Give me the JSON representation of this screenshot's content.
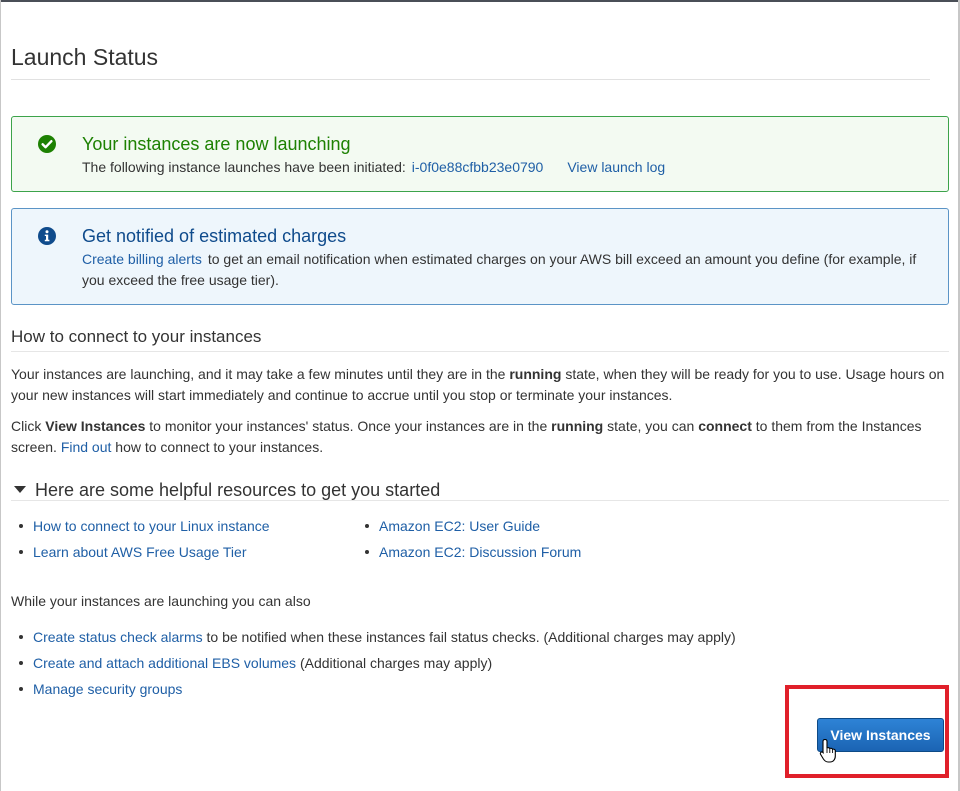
{
  "page": {
    "title": "Launch Status"
  },
  "success_alert": {
    "title": "Your instances are now launching",
    "body_prefix": "The following instance launches have been initiated:",
    "instance_id": "i-0f0e88cfbb23e0790",
    "view_log_link": "View launch log",
    "icon": "check-circle-icon",
    "color": "#1d8102"
  },
  "info_alert": {
    "title": "Get notified of estimated charges",
    "link": "Create billing alerts",
    "body": "to get an email notification when estimated charges on your AWS bill exceed an amount you define (for example, if you exceed the free usage tier).",
    "icon": "info-circle-icon",
    "color": "#0f4b8c"
  },
  "connect": {
    "heading": "How to connect to your instances",
    "para1": {
      "a": "Your instances are launching, and it may take a few minutes until they are in the",
      "b_running": "running",
      "c": "state, when they will be ready for you to use. Usage hours on your new instances will start immediately and continue to accrue until you stop or terminate your instances."
    },
    "para2": {
      "a": "Click",
      "b_view": "View Instances",
      "c": "to monitor your instances' status. Once your instances are in the",
      "d_running": "running",
      "e": "state, you can",
      "f_connect": "connect",
      "g": "to them from the Instances screen.",
      "link": "Find out",
      "h": "how to connect to your instances."
    }
  },
  "resources": {
    "heading": "Here are some helpful resources to get you started",
    "left": [
      "How to connect to your Linux instance",
      "Learn about AWS Free Usage Tier"
    ],
    "right": [
      "Amazon EC2: User Guide",
      "Amazon EC2: Discussion Forum"
    ]
  },
  "also": {
    "intro": "While your instances are launching you can also",
    "items": [
      {
        "link": "Create status check alarms",
        "tail": "to be notified when these instances fail status checks. (Additional charges may apply)"
      },
      {
        "link": "Create and attach additional EBS volumes",
        "tail": "(Additional charges may apply)"
      },
      {
        "link": "Manage security groups",
        "tail": ""
      }
    ]
  },
  "actions": {
    "view_instances": "View Instances",
    "highlight_color": "#e0202a"
  }
}
